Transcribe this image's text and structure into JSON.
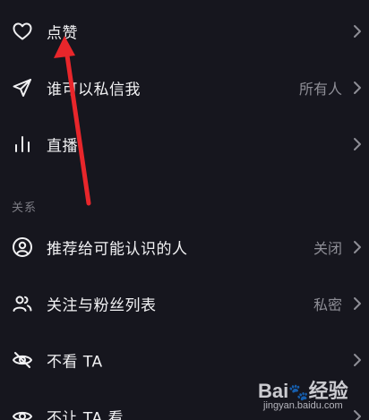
{
  "rows": [
    {
      "label": "点赞",
      "value": "",
      "icon": "heart-icon"
    },
    {
      "label": "谁可以私信我",
      "value": "所有人",
      "icon": "send-icon"
    },
    {
      "label": "直播",
      "value": "",
      "icon": "live-bars-icon"
    }
  ],
  "section": {
    "title": "关系"
  },
  "relation_rows": [
    {
      "label": "推荐给可能认识的人",
      "value": "关闭",
      "icon": "user-circle-icon"
    },
    {
      "label": "关注与粉丝列表",
      "value": "私密",
      "icon": "users-icon"
    },
    {
      "label": "不看 TA",
      "value": "",
      "icon": "eye-off-icon"
    },
    {
      "label": "不让 TA 看",
      "value": "",
      "icon": "eye-lock-icon"
    }
  ],
  "watermark": {
    "logo": "Bai",
    "logo_suffix": "经验",
    "url": "jingyan.baidu.com"
  },
  "colors": {
    "background": "#16161e",
    "text": "#f2f2f4",
    "secondary": "#8e8e96",
    "arrow": "#e8262b"
  }
}
